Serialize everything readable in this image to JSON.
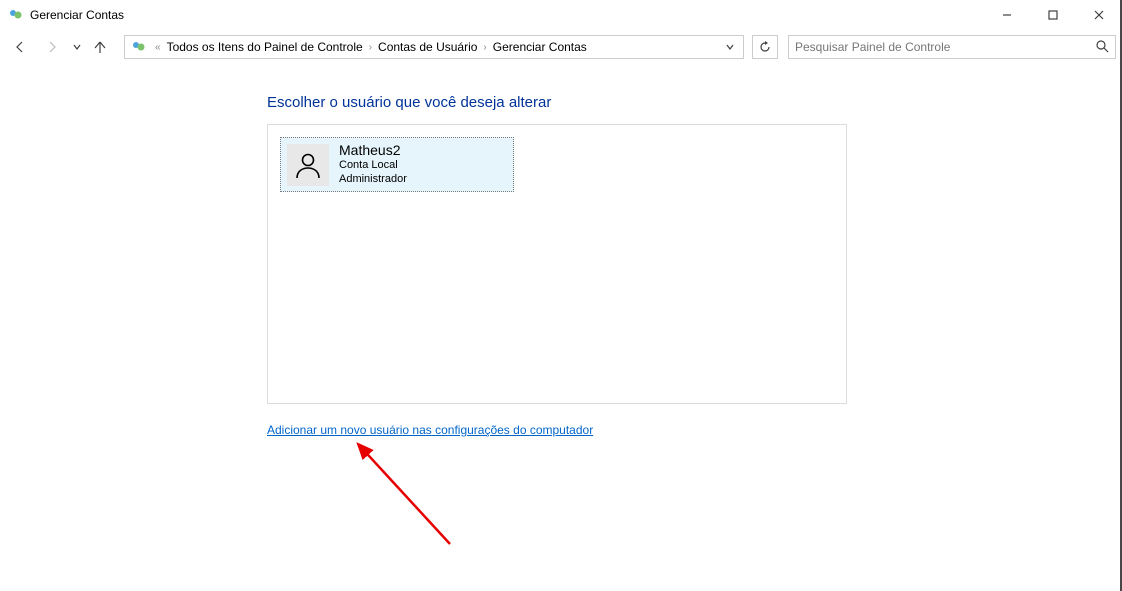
{
  "window": {
    "title": "Gerenciar Contas"
  },
  "breadcrumb": {
    "prefix": "«",
    "items": [
      "Todos os Itens do Painel de Controle",
      "Contas de Usuário",
      "Gerenciar Contas"
    ]
  },
  "search": {
    "placeholder": "Pesquisar Painel de Controle"
  },
  "main": {
    "heading": "Escolher o usuário que você deseja alterar",
    "accounts": [
      {
        "name": "Matheus2",
        "type": "Conta Local",
        "role": "Administrador"
      }
    ],
    "add_user_link": "Adicionar um novo usuário nas configurações do computador"
  }
}
